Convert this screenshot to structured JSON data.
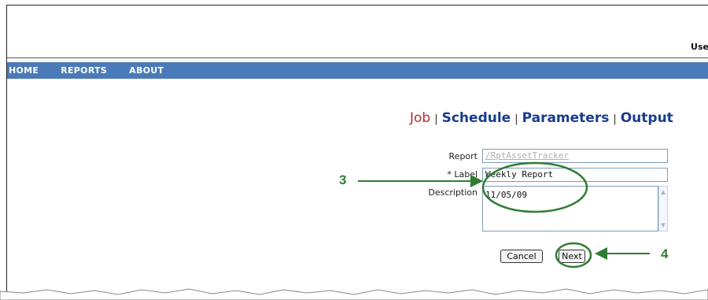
{
  "header": {
    "user_text": "Use"
  },
  "nav": {
    "items": [
      "HOME",
      "REPORTS",
      "ABOUT"
    ]
  },
  "wizard": {
    "steps": {
      "job": "Job",
      "schedule": "Schedule",
      "parameters": "Parameters",
      "output": "Output"
    }
  },
  "form": {
    "report_label": "Report",
    "report_value": "/RptAssetTracker",
    "label_label": "* Label",
    "label_value": "Weekly Report",
    "description_label": "Description",
    "description_value": "11/05/09"
  },
  "buttons": {
    "cancel": "Cancel",
    "next": "Next"
  },
  "callouts": {
    "three": "3",
    "four": "4"
  },
  "colors": {
    "nav_bg": "#4a7bb8",
    "active_step": "#b52e2e",
    "step_link": "#1a3c8e",
    "callout": "#2e7d32"
  }
}
